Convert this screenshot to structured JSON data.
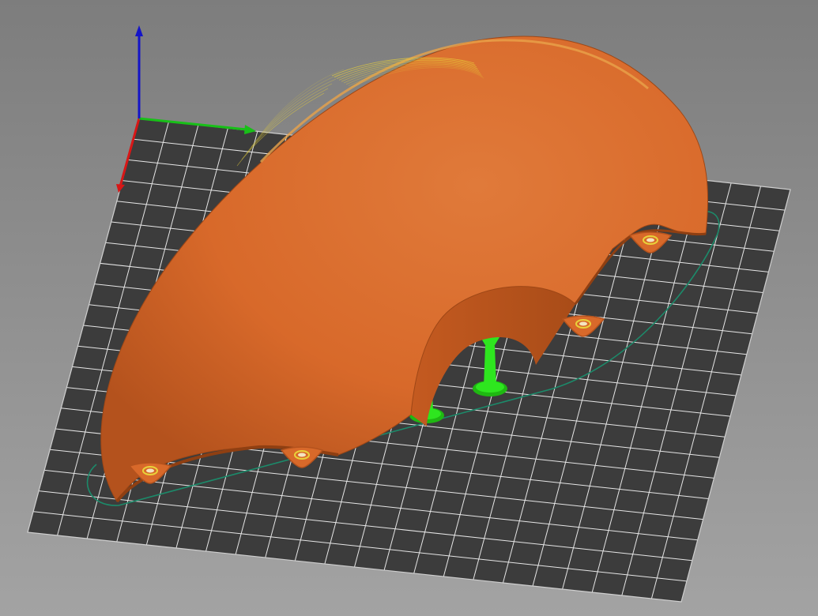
{
  "viewport": {
    "kind": "3d-gcode-preview",
    "background_top": "#7d7d7d",
    "background_bottom": "#a3a3a3"
  },
  "bed": {
    "surface_color": "#3c3c3c",
    "grid_color": "#e6e6e6",
    "grid_divisions_u": 22,
    "grid_divisions_v": 20
  },
  "axes": {
    "x_color": "#d81616",
    "y_color": "#18c018",
    "z_color": "#1414c8"
  },
  "model": {
    "shell_color": "#d8692a",
    "shell_dark": "#b4521d",
    "highlight_color": "#e8d23a",
    "skirt_color": "#1c8a6a",
    "support_color": "#2ee61f",
    "support_dark": "#1fb812",
    "brim_pads": 5,
    "tree_supports": 2
  }
}
